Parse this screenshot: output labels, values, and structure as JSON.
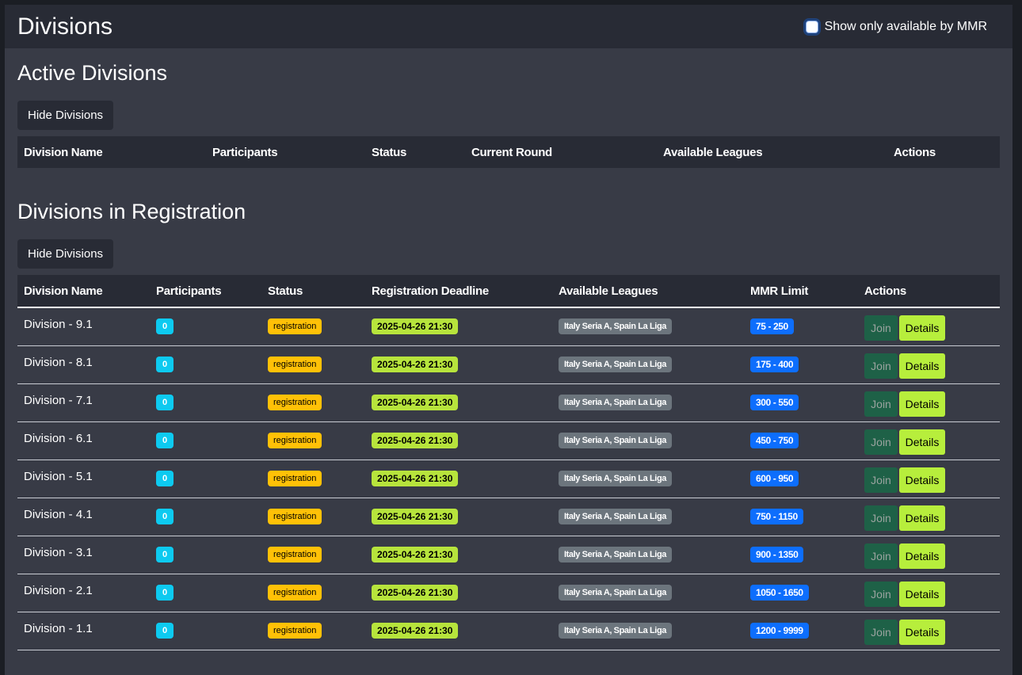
{
  "header": {
    "title": "Divisions",
    "mmr_filter_label": "Show only available by MMR"
  },
  "active": {
    "title": "Active Divisions",
    "hide_label": "Hide Divisions",
    "columns": [
      "Division Name",
      "Participants",
      "Status",
      "Current Round",
      "Available Leagues",
      "Actions"
    ]
  },
  "registration": {
    "title": "Divisions in Registration",
    "hide_label": "Hide Divisions",
    "columns": [
      "Division Name",
      "Participants",
      "Status",
      "Registration Deadline",
      "Available Leagues",
      "MMR Limit",
      "Actions"
    ],
    "join_label": "Join",
    "details_label": "Details",
    "rows": [
      {
        "name": "Division - 9.1",
        "participants": "0",
        "status": "registration",
        "deadline": "2025-04-26 21:30",
        "leagues": "Italy Seria A, Spain La Liga",
        "mmr": "75 - 250"
      },
      {
        "name": "Division - 8.1",
        "participants": "0",
        "status": "registration",
        "deadline": "2025-04-26 21:30",
        "leagues": "Italy Seria A, Spain La Liga",
        "mmr": "175 - 400"
      },
      {
        "name": "Division - 7.1",
        "participants": "0",
        "status": "registration",
        "deadline": "2025-04-26 21:30",
        "leagues": "Italy Seria A, Spain La Liga",
        "mmr": "300 - 550"
      },
      {
        "name": "Division - 6.1",
        "participants": "0",
        "status": "registration",
        "deadline": "2025-04-26 21:30",
        "leagues": "Italy Seria A, Spain La Liga",
        "mmr": "450 - 750"
      },
      {
        "name": "Division - 5.1",
        "participants": "0",
        "status": "registration",
        "deadline": "2025-04-26 21:30",
        "leagues": "Italy Seria A, Spain La Liga",
        "mmr": "600 - 950"
      },
      {
        "name": "Division - 4.1",
        "participants": "0",
        "status": "registration",
        "deadline": "2025-04-26 21:30",
        "leagues": "Italy Seria A, Spain La Liga",
        "mmr": "750 - 1150"
      },
      {
        "name": "Division - 3.1",
        "participants": "0",
        "status": "registration",
        "deadline": "2025-04-26 21:30",
        "leagues": "Italy Seria A, Spain La Liga",
        "mmr": "900 - 1350"
      },
      {
        "name": "Division - 2.1",
        "participants": "0",
        "status": "registration",
        "deadline": "2025-04-26 21:30",
        "leagues": "Italy Seria A, Spain La Liga",
        "mmr": "1050 - 1650"
      },
      {
        "name": "Division - 1.1",
        "participants": "0",
        "status": "registration",
        "deadline": "2025-04-26 21:30",
        "leagues": "Italy Seria A, Spain La Liga",
        "mmr": "1200 - 9999"
      }
    ]
  },
  "colors": {
    "page_bg": "#1b1e24",
    "card_bg": "#383b46",
    "header_bg": "#282b35",
    "participants": "#0dcaf0",
    "status": "#ffc107",
    "deadline": "#b7e43c",
    "leagues": "#6c757d",
    "mmr": "#0d6efd",
    "join": "#1e6147",
    "details": "#b7ee3c"
  }
}
